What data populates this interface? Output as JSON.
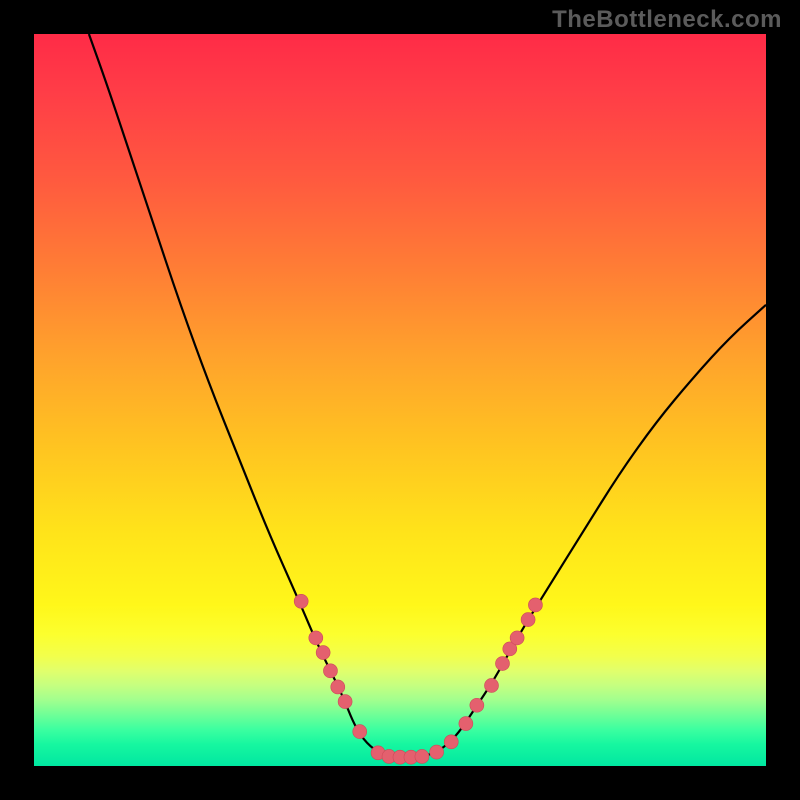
{
  "watermark": "TheBottleneck.com",
  "chart_data": {
    "type": "line",
    "title": "",
    "xlabel": "",
    "ylabel": "",
    "xlim": [
      0,
      100
    ],
    "ylim": [
      0,
      100
    ],
    "grid": false,
    "legend": false,
    "curve": {
      "points": [
        {
          "x": 7.5,
          "y": 100
        },
        {
          "x": 10,
          "y": 93
        },
        {
          "x": 13,
          "y": 84
        },
        {
          "x": 16,
          "y": 75
        },
        {
          "x": 20,
          "y": 63
        },
        {
          "x": 24,
          "y": 52
        },
        {
          "x": 28,
          "y": 42
        },
        {
          "x": 32,
          "y": 32
        },
        {
          "x": 36,
          "y": 23
        },
        {
          "x": 39,
          "y": 16
        },
        {
          "x": 42,
          "y": 10
        },
        {
          "x": 44,
          "y": 5
        },
        {
          "x": 46,
          "y": 2.5
        },
        {
          "x": 48,
          "y": 1.5
        },
        {
          "x": 50,
          "y": 1.2
        },
        {
          "x": 52,
          "y": 1.2
        },
        {
          "x": 54,
          "y": 1.5
        },
        {
          "x": 56,
          "y": 2.5
        },
        {
          "x": 58,
          "y": 4.5
        },
        {
          "x": 60,
          "y": 7.5
        },
        {
          "x": 63,
          "y": 12
        },
        {
          "x": 66,
          "y": 17.5
        },
        {
          "x": 70,
          "y": 24
        },
        {
          "x": 75,
          "y": 32
        },
        {
          "x": 80,
          "y": 40
        },
        {
          "x": 85,
          "y": 47
        },
        {
          "x": 90,
          "y": 53
        },
        {
          "x": 95,
          "y": 58.5
        },
        {
          "x": 100,
          "y": 63
        }
      ]
    },
    "markers": [
      {
        "x": 36.5,
        "y": 22.5
      },
      {
        "x": 38.5,
        "y": 17.5
      },
      {
        "x": 39.5,
        "y": 15.5
      },
      {
        "x": 40.5,
        "y": 13.0
      },
      {
        "x": 41.5,
        "y": 10.8
      },
      {
        "x": 42.5,
        "y": 8.8
      },
      {
        "x": 44.5,
        "y": 4.7
      },
      {
        "x": 47.0,
        "y": 1.8
      },
      {
        "x": 48.5,
        "y": 1.3
      },
      {
        "x": 50.0,
        "y": 1.2
      },
      {
        "x": 51.5,
        "y": 1.2
      },
      {
        "x": 53.0,
        "y": 1.3
      },
      {
        "x": 55.0,
        "y": 1.9
      },
      {
        "x": 57.0,
        "y": 3.3
      },
      {
        "x": 59.0,
        "y": 5.8
      },
      {
        "x": 60.5,
        "y": 8.3
      },
      {
        "x": 62.5,
        "y": 11.0
      },
      {
        "x": 64.0,
        "y": 14.0
      },
      {
        "x": 65.0,
        "y": 16.0
      },
      {
        "x": 66.0,
        "y": 17.5
      },
      {
        "x": 67.5,
        "y": 20.0
      },
      {
        "x": 68.5,
        "y": 22.0
      }
    ]
  }
}
